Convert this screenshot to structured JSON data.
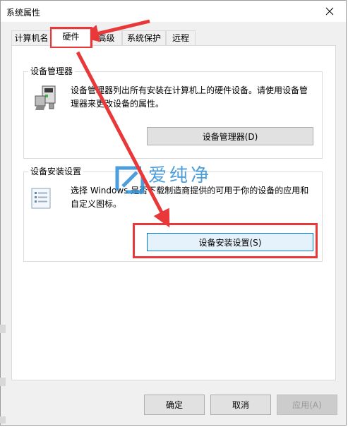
{
  "window": {
    "title": "系统属性"
  },
  "tabs": [
    {
      "label": "计算机名"
    },
    {
      "label": "硬件"
    },
    {
      "label": "高级"
    },
    {
      "label": "系统保护"
    },
    {
      "label": "远程"
    }
  ],
  "device_manager": {
    "group_title": "设备管理器",
    "description_line1": "设备管理器列出所有安装在计算机上的硬件设备。请使用设备管",
    "description_line2": "理器来更改设备的属性。",
    "button_label": "设备管理器(D)"
  },
  "device_install": {
    "group_title": "设备安装设置",
    "description_line1": "选择 Windows 是否下载制造商提供的可用于你的设备的应用和",
    "description_line2": "自定义图标。",
    "button_label": "设备安装设置(S)"
  },
  "watermark": {
    "text": "爱纯净"
  },
  "footer": {
    "ok_label": "确定",
    "cancel_label": "取消",
    "apply_label": "应用(A)"
  },
  "colors": {
    "annotation_red": "#e8383a",
    "watermark_blue": "#2f8fd6",
    "focus_blue": "#0078d7"
  }
}
